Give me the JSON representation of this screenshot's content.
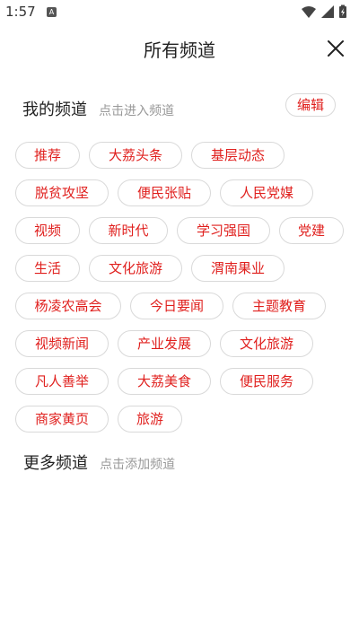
{
  "status_bar": {
    "time": "1:57",
    "notification_badge": "A",
    "icons": [
      "wifi-icon",
      "cellular-signal-icon",
      "battery-charging-icon"
    ]
  },
  "header": {
    "title": "所有频道",
    "close_icon": "close-icon"
  },
  "my_channels": {
    "title": "我的频道",
    "hint": "点击进入频道",
    "edit_label": "编辑",
    "rows": [
      [
        "推荐",
        "大荔头条",
        "基层动态"
      ],
      [
        "脱贫攻坚",
        "便民张贴",
        "人民党媒"
      ],
      [
        "视频",
        "新时代",
        "学习强国",
        "党建"
      ],
      [
        "生活",
        "文化旅游",
        "渭南果业"
      ],
      [
        "杨凌农高会",
        "今日要闻",
        "主题教育"
      ],
      [
        "视频新闻",
        "产业发展",
        "文化旅游"
      ],
      [
        "凡人善举",
        "大荔美食",
        "便民服务"
      ],
      [
        "商家黄页",
        "旅游"
      ]
    ]
  },
  "more_channels": {
    "title": "更多频道",
    "hint": "点击添加频道"
  },
  "colors": {
    "accent": "#e0201e",
    "chip_border": "#d9d9d9",
    "hint_text": "#999999"
  }
}
